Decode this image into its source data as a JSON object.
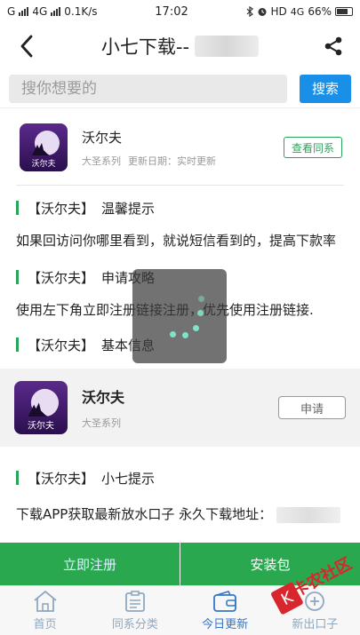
{
  "status_bar": {
    "carrier_left": "G",
    "network": "4G",
    "speed": "0.1K/s",
    "time": "17:02",
    "right_icons": "HD",
    "network_right": "4G",
    "battery": "66%"
  },
  "navbar": {
    "title": "小七下载--"
  },
  "search": {
    "placeholder": "搜你想要的",
    "button": "搜索"
  },
  "app_top": {
    "name": "沃尔夫",
    "series": "大圣系列",
    "update_label": "更新日期：实时更新",
    "view_button": "查看同系",
    "icon_text": "沃尔夫"
  },
  "sections": {
    "tips_bracket": "【沃尔夫】",
    "tips_title": "温馨提示",
    "tips_text": "如果回访问你哪里看到，就说短信看到的，提高下款率",
    "strategy_bracket": "【沃尔夫】",
    "strategy_title": "申请攻略",
    "strategy_text": "使用左下角立即注册链接注册，优先使用注册链接.",
    "basic_bracket": "【沃尔夫】",
    "basic_title": "基本信息",
    "hint_bracket": "【沃尔夫】",
    "hint_title": "小七提示",
    "hint_text": "下载APP获取最新放水口子 永久下载地址："
  },
  "app_card": {
    "name": "沃尔夫",
    "series": "大圣系列",
    "apply_button": "申请",
    "icon_text": "沃尔夫"
  },
  "actions": {
    "register": "立即注册",
    "install": "安装包"
  },
  "tabs": [
    {
      "label": "首页",
      "icon": "home-icon"
    },
    {
      "label": "同系分类",
      "icon": "clipboard-icon"
    },
    {
      "label": "今日更新",
      "icon": "wallet-icon"
    },
    {
      "label": "新出口子",
      "icon": "new-icon"
    }
  ],
  "watermark": {
    "text": "卡农社区"
  },
  "colors": {
    "accent_green": "#2aa84f",
    "search_blue": "#1a8fe8",
    "tab_active": "#3376c9"
  }
}
